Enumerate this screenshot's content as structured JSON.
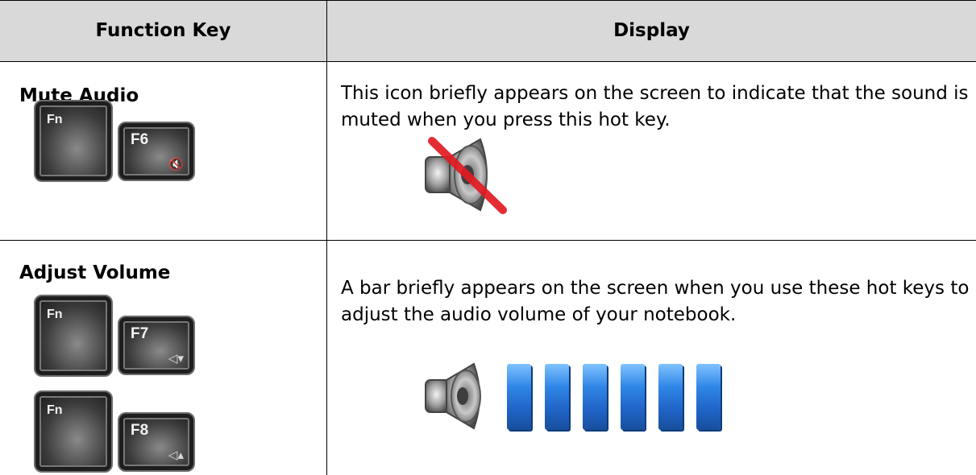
{
  "header": {
    "function_key": "Function Key",
    "display": "Display"
  },
  "rows": [
    {
      "title": "Mute Audio",
      "description": "This icon briefly appears on the screen to indicate that the sound is muted when you press this hot key.",
      "keys": [
        {
          "label": "Fn",
          "glyph": ""
        },
        {
          "label": "F6",
          "glyph": "🔇"
        }
      ]
    },
    {
      "title": "Adjust Volume",
      "description": "A bar briefly appears on the screen when you use these hot keys to adjust the audio volume of your notebook.",
      "keys": [
        {
          "label": "Fn",
          "glyph": ""
        },
        {
          "label": "F7",
          "glyph": "◁▾"
        },
        {
          "label": "Fn",
          "glyph": ""
        },
        {
          "label": "F8",
          "glyph": "◁▴"
        }
      ],
      "volume_bars": 6
    }
  ],
  "colors": {
    "header_bg": "#d9d9d9",
    "bar_blue": "#2f86e6",
    "mute_red": "#e21b23"
  }
}
